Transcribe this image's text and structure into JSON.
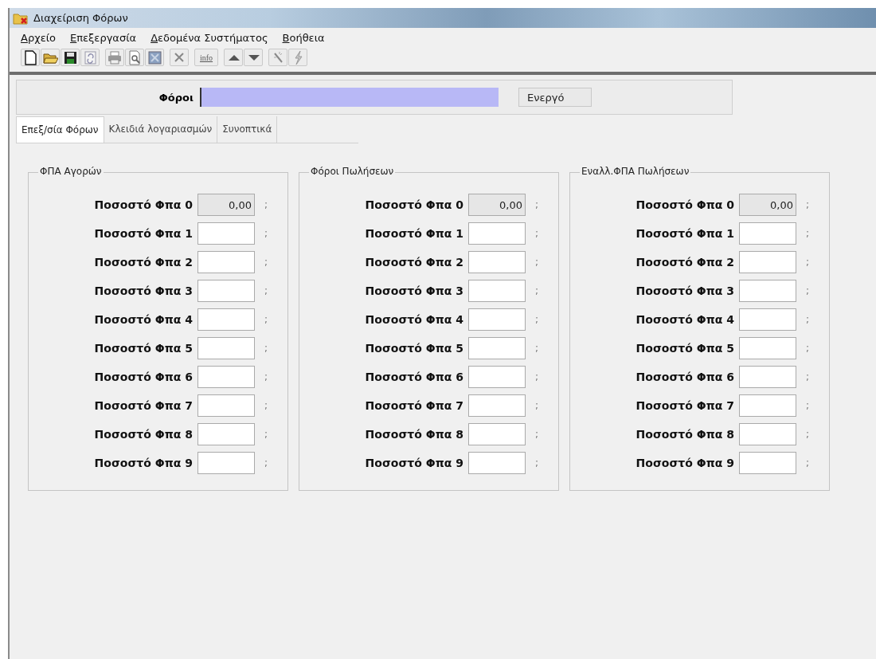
{
  "window": {
    "title": "Διαχείριση Φόρων"
  },
  "menu": [
    "Αρχείο",
    "Επεξεργασία",
    "Δεδομένα Συστήματος",
    "Βοήθεια"
  ],
  "toolbar": {
    "info_label": "info"
  },
  "header": {
    "label": "Φόροι",
    "button": "Ενεργό"
  },
  "tabs": [
    {
      "label": "Επεξ/σία Φόρων",
      "selected": true
    },
    {
      "label": "Κλειδιά λογαριασμών",
      "selected": false
    },
    {
      "label": "Συνοπτικά",
      "selected": false
    }
  ],
  "groups": [
    {
      "title": "ΦΠΑ Αγορών",
      "rows": [
        {
          "label": "Ποσοστό Φπα 0",
          "value": "0,00",
          "disabled": true,
          "suffix": ";"
        },
        {
          "label": "Ποσοστό Φπα 1",
          "disabled": false,
          "suffix": ";"
        },
        {
          "label": "Ποσοστό Φπα 2",
          "disabled": false,
          "suffix": ";"
        },
        {
          "label": "Ποσοστό Φπα 3",
          "disabled": false,
          "suffix": ";"
        },
        {
          "label": "Ποσοστό Φπα 4",
          "disabled": false,
          "suffix": ";"
        },
        {
          "label": "Ποσοστό Φπα 5",
          "disabled": false,
          "suffix": ";"
        },
        {
          "label": "Ποσοστό Φπα 6",
          "disabled": false,
          "suffix": ";"
        },
        {
          "label": "Ποσοστό Φπα 7",
          "disabled": false,
          "suffix": ";"
        },
        {
          "label": "Ποσοστό Φπα 8",
          "disabled": false,
          "suffix": ";"
        },
        {
          "label": "Ποσοστό Φπα 9",
          "disabled": false,
          "suffix": ";"
        }
      ]
    },
    {
      "title": "Φόροι Πωλήσεων",
      "rows": [
        {
          "label": "Ποσοστό Φπα 0",
          "value": "0,00",
          "disabled": true,
          "suffix": ";"
        },
        {
          "label": "Ποσοστό Φπα 1",
          "disabled": false,
          "suffix": ";"
        },
        {
          "label": "Ποσοστό Φπα 2",
          "disabled": false,
          "suffix": ";"
        },
        {
          "label": "Ποσοστό Φπα 3",
          "disabled": false,
          "suffix": ";"
        },
        {
          "label": "Ποσοστό Φπα 4",
          "disabled": false,
          "suffix": ";"
        },
        {
          "label": "Ποσοστό Φπα 5",
          "disabled": false,
          "suffix": ";"
        },
        {
          "label": "Ποσοστό Φπα 6",
          "disabled": false,
          "suffix": ";"
        },
        {
          "label": "Ποσοστό Φπα 7",
          "disabled": false,
          "suffix": ";"
        },
        {
          "label": "Ποσοστό Φπα 8",
          "disabled": false,
          "suffix": ";"
        },
        {
          "label": "Ποσοστό Φπα 9",
          "disabled": false,
          "suffix": ";"
        }
      ]
    },
    {
      "title": "Εναλλ.ΦΠΑ Πωλήσεων",
      "rows": [
        {
          "label": "Ποσοστό Φπα 0",
          "value": "0,00",
          "disabled": true,
          "suffix": ";"
        },
        {
          "label": "Ποσοστό Φπα 1",
          "disabled": false,
          "suffix": ";"
        },
        {
          "label": "Ποσοστό Φπα 2",
          "disabled": false,
          "suffix": ";"
        },
        {
          "label": "Ποσοστό Φπα 3",
          "disabled": false,
          "suffix": ";"
        },
        {
          "label": "Ποσοστό Φπα 4",
          "disabled": false,
          "suffix": ";"
        },
        {
          "label": "Ποσοστό Φπα 5",
          "disabled": false,
          "suffix": ";"
        },
        {
          "label": "Ποσοστό Φπα 6",
          "disabled": false,
          "suffix": ";"
        },
        {
          "label": "Ποσοστό Φπα 7",
          "disabled": false,
          "suffix": ";"
        },
        {
          "label": "Ποσοστό Φπα 8",
          "disabled": false,
          "suffix": ";"
        },
        {
          "label": "Ποσοστό Φπα 9",
          "disabled": false,
          "suffix": ";"
        }
      ]
    }
  ]
}
